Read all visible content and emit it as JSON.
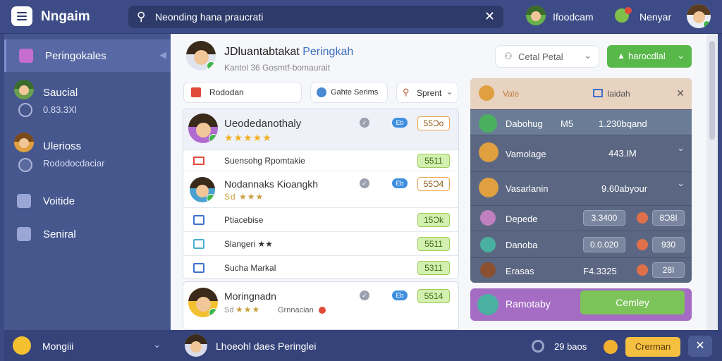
{
  "app": {
    "title": "Nngaim"
  },
  "search": {
    "value": "Neonding hana praucrati"
  },
  "top_users": [
    {
      "name": "Ifoodcam"
    },
    {
      "name": "Nenyar"
    }
  ],
  "sidebar": {
    "items": [
      {
        "label": "Peringokales"
      },
      {
        "label": "Saucial",
        "sub": "0.83.3Xl"
      },
      {
        "label": "Ulerioss",
        "sub": "Rododocdaciar"
      },
      {
        "label": "Voitide"
      },
      {
        "label": "Seniral"
      }
    ],
    "footer": {
      "label": "Mongiii"
    }
  },
  "profile": {
    "name": "JDluantabtakat",
    "name_accent": "Peringkah",
    "subtitle": "Kantol 36 Gosmtf-bomaurait"
  },
  "controls": {
    "select_label": "Cetal Petal",
    "action_label": "harocdlal"
  },
  "filters": [
    {
      "label": "Rododan"
    },
    {
      "label": "Gahte Serims"
    },
    {
      "label": "Sprent"
    }
  ],
  "list": [
    {
      "title": "Ueodedanothaly",
      "stars": "★★★★★",
      "badge": "Eb",
      "price": "55Ɔo"
    },
    {
      "title": "Suensohg Rpomtakie",
      "price": "5511"
    },
    {
      "title": "Nodannaks Kioangkh",
      "stars": "Sd ★★★",
      "badge": "Eb",
      "price": "55Ɔ4"
    },
    {
      "title": "Ptiacebise",
      "price": "15Ɔk"
    },
    {
      "title": "Slangeri ★★",
      "price": "5511"
    },
    {
      "title": "Sucha Markal",
      "price": "5311"
    },
    {
      "title": "Moringnadn",
      "stars_prefix": "Sd",
      "stars": "★★★",
      "extra": "Grnnacian",
      "badge": "Eb",
      "price": "5514"
    }
  ],
  "right_panel": {
    "header": {
      "left": "Vale",
      "right": "Iaidah"
    },
    "rows": [
      {
        "name": "Dabohug",
        "mid": "M5",
        "value": "1.230bqand"
      },
      {
        "name": "Vamolage",
        "value": "443.IM"
      },
      {
        "name": "Vasarlanin",
        "value": "9.60abyour"
      },
      {
        "name": "Depede",
        "box1": "3.3400",
        "box2": "8Ɔ8I"
      },
      {
        "name": "Danoba",
        "box1": "0.0.020",
        "box2": "930"
      },
      {
        "name": "Erasas",
        "box1": "F4.3325",
        "box2": "28I"
      }
    ],
    "footer": {
      "name": "Ramotaby",
      "button": "Cemley"
    }
  },
  "bottom": {
    "user": "Lhoeohl daes Peringlei",
    "count": "29 baos",
    "button": "Crerman"
  },
  "colors": {
    "sidebar": "#46578e",
    "topbar": "#3d4c86",
    "accent_green": "#58b84a"
  }
}
